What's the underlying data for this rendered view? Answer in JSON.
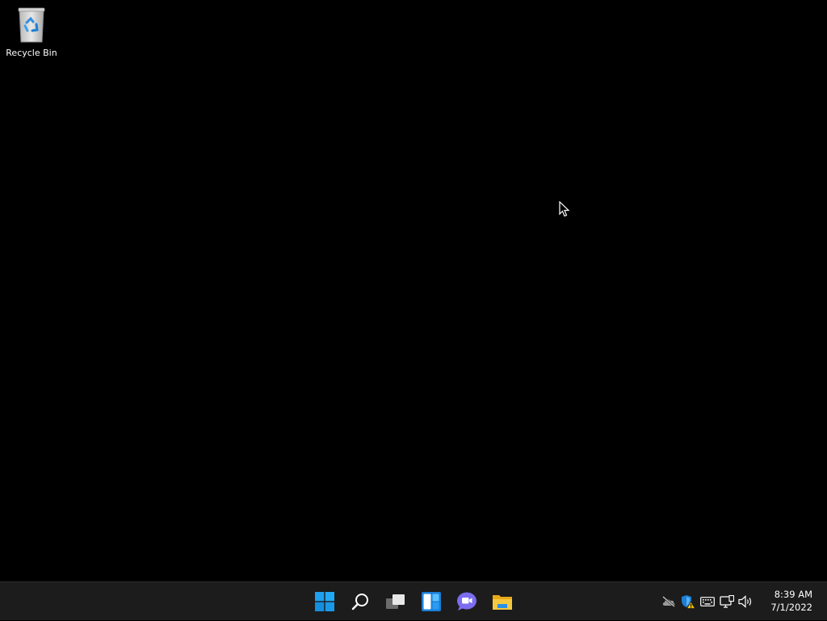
{
  "desktop": {
    "icons": [
      {
        "label": "Recycle Bin",
        "icon": "recycle-bin-icon"
      }
    ],
    "background_color": "#000000"
  },
  "taskbar": {
    "background_color": "#1c1c1c",
    "pinned": [
      {
        "icon": "windows-start-icon"
      },
      {
        "icon": "search-icon"
      },
      {
        "icon": "task-view-icon"
      },
      {
        "icon": "widgets-icon"
      },
      {
        "icon": "chat-icon"
      },
      {
        "icon": "file-explorer-icon"
      }
    ],
    "tray": [
      {
        "icon": "onedrive-offline-icon"
      },
      {
        "icon": "security-warning-icon"
      },
      {
        "icon": "keyboard-icon"
      },
      {
        "icon": "network-icon"
      },
      {
        "icon": "volume-icon"
      }
    ],
    "clock": {
      "time": "8:39 AM",
      "date": "7/1/2022"
    }
  }
}
